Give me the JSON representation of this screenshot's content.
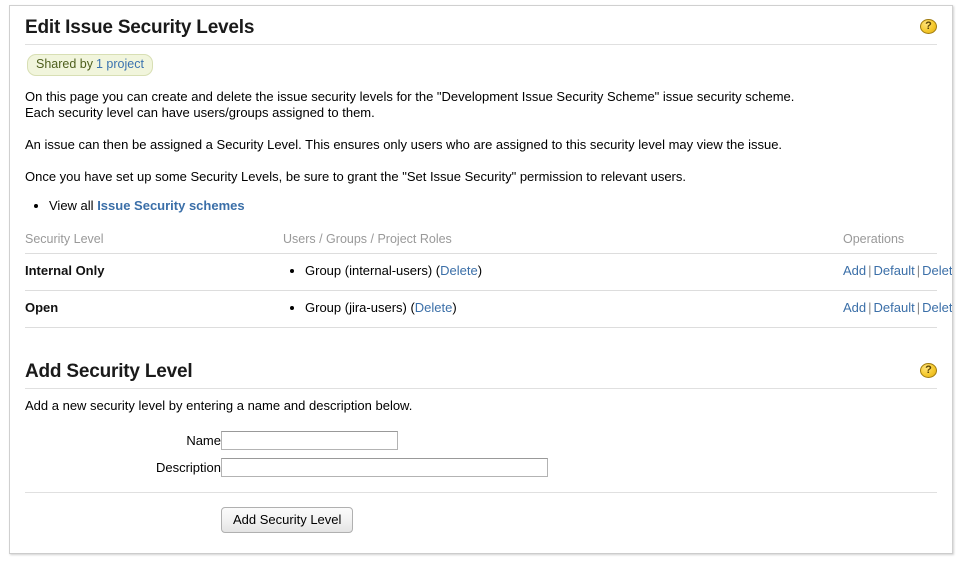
{
  "panel": {
    "title": "Edit Issue Security Levels",
    "help_icon": "help-icon",
    "help_glyph": "?",
    "shared_badge": {
      "label": "Shared by",
      "count_link": "1 project"
    },
    "paragraphs": {
      "p1_line1": "On this page you can create and delete the issue security levels for the \"Development Issue Security Scheme\" issue security scheme.",
      "p1_line2": "Each security level can have users/groups assigned to them.",
      "p2": "An issue can then be assigned a Security Level. This ensures only users who are assigned to this security level may view the issue.",
      "p3": "Once you have set up some Security Levels, be sure to grant the \"Set Issue Security\" permission to relevant users."
    },
    "bullet": {
      "prefix": "View all",
      "link": "Issue Security schemes"
    }
  },
  "levels_table": {
    "headers": {
      "level": "Security Level",
      "users": "Users / Groups / Project Roles",
      "operations": "Operations"
    },
    "rows": [
      {
        "name": "Internal Only",
        "member_prefix": "Group (internal-users) (",
        "member_delete": "Delete",
        "member_suffix": ")",
        "ops": {
          "add": "Add",
          "default": "Default",
          "delete": "Delete",
          "separator": "|"
        }
      },
      {
        "name": "Open",
        "member_prefix": "Group (jira-users) (",
        "member_delete": "Delete",
        "member_suffix": ")",
        "ops": {
          "add": "Add",
          "default": "Default",
          "delete": "Delete",
          "separator": "|"
        }
      }
    ]
  },
  "add_section": {
    "title": "Add Security Level",
    "help_glyph": "?",
    "description": "Add a new security level by entering a name and description below.",
    "fields": {
      "name_label": "Name",
      "name_value": "",
      "name_placeholder": "",
      "description_label": "Description",
      "description_value": "",
      "description_placeholder": ""
    },
    "submit_label": "Add Security Level"
  },
  "colors": {
    "link": "#3b6fa8",
    "badge_bg": "#f1f5dc",
    "badge_border": "#d8dfb4",
    "help_icon": "#f5c92e",
    "header_text": "#999999",
    "rule": "#dddddd"
  }
}
